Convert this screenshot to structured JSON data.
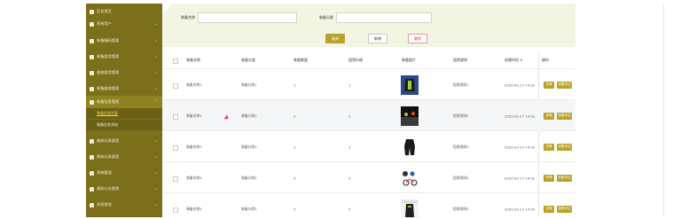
{
  "sidebar": {
    "items": [
      {
        "label": "后台首页",
        "icon": "home-icon"
      },
      {
        "label": "系统用户",
        "icon": "user-icon"
      },
      {
        "label": "装备编码管理",
        "icon": "grid-icon"
      },
      {
        "label": "装备类型管理",
        "icon": "grid-icon"
      },
      {
        "label": "维修类型管理",
        "icon": "grid-icon"
      },
      {
        "label": "装备维修管理",
        "icon": "grid-icon"
      },
      {
        "label": "装备信息管理",
        "icon": "grid-icon"
      },
      {
        "label": "维修记录管理",
        "icon": "grid-icon"
      },
      {
        "label": "报废记录管理",
        "icon": "grid-icon"
      },
      {
        "label": "系统管理",
        "icon": "gear-icon"
      },
      {
        "label": "通知公告管理",
        "icon": "grid-icon"
      },
      {
        "label": "消息管理",
        "icon": "gear-icon"
      }
    ],
    "subitems": [
      "装备信息列表",
      "装备信息添加"
    ]
  },
  "search": {
    "name_label": "装备名称",
    "name_value": "",
    "type_label": "装备分类",
    "type_value": "",
    "query_button": "查询",
    "add_button": "新增",
    "delete_button": "删除"
  },
  "table": {
    "headers": [
      "装备名称",
      "装备分类",
      "装备数量",
      "租赁价格",
      "装备图片",
      "租赁规则",
      "创建时间 ⇕",
      "操作"
    ],
    "rows": [
      {
        "name": "装备名称1",
        "type": "装备分类1",
        "qty": "1",
        "price": "1",
        "rule": "租赁规则1",
        "time": "2025-02-17 14:32",
        "img": "jacket-green"
      },
      {
        "name": "装备名称2",
        "type": "装备分类2",
        "qty": "2",
        "price": "2",
        "rule": "租赁规则2",
        "time": "2025-02-17 14:32",
        "img": "racing-scene"
      },
      {
        "name": "装备名称3",
        "type": "装备分类3",
        "qty": "3",
        "price": "3",
        "rule": "租赁规则3",
        "time": "2025-02-17 14:32",
        "img": "black-suit"
      },
      {
        "name": "装备名称4",
        "type": "装备分类4",
        "qty": "4",
        "price": "4",
        "rule": "租赁规则4",
        "time": "2025-02-17 14:32",
        "img": "helmet-bike"
      },
      {
        "name": "装备名称5",
        "type": "装备分类5",
        "qty": "5",
        "price": "5",
        "rule": "租赁规则5",
        "time": "2025-02-17 14:32",
        "img": "jacket-poster"
      }
    ],
    "action_edit": "详情",
    "action_view": "查看评论"
  },
  "colors": {
    "sidebar": "#7b6f1c",
    "accent": "#b8a32c",
    "header_bg": "#f3f5e3"
  }
}
